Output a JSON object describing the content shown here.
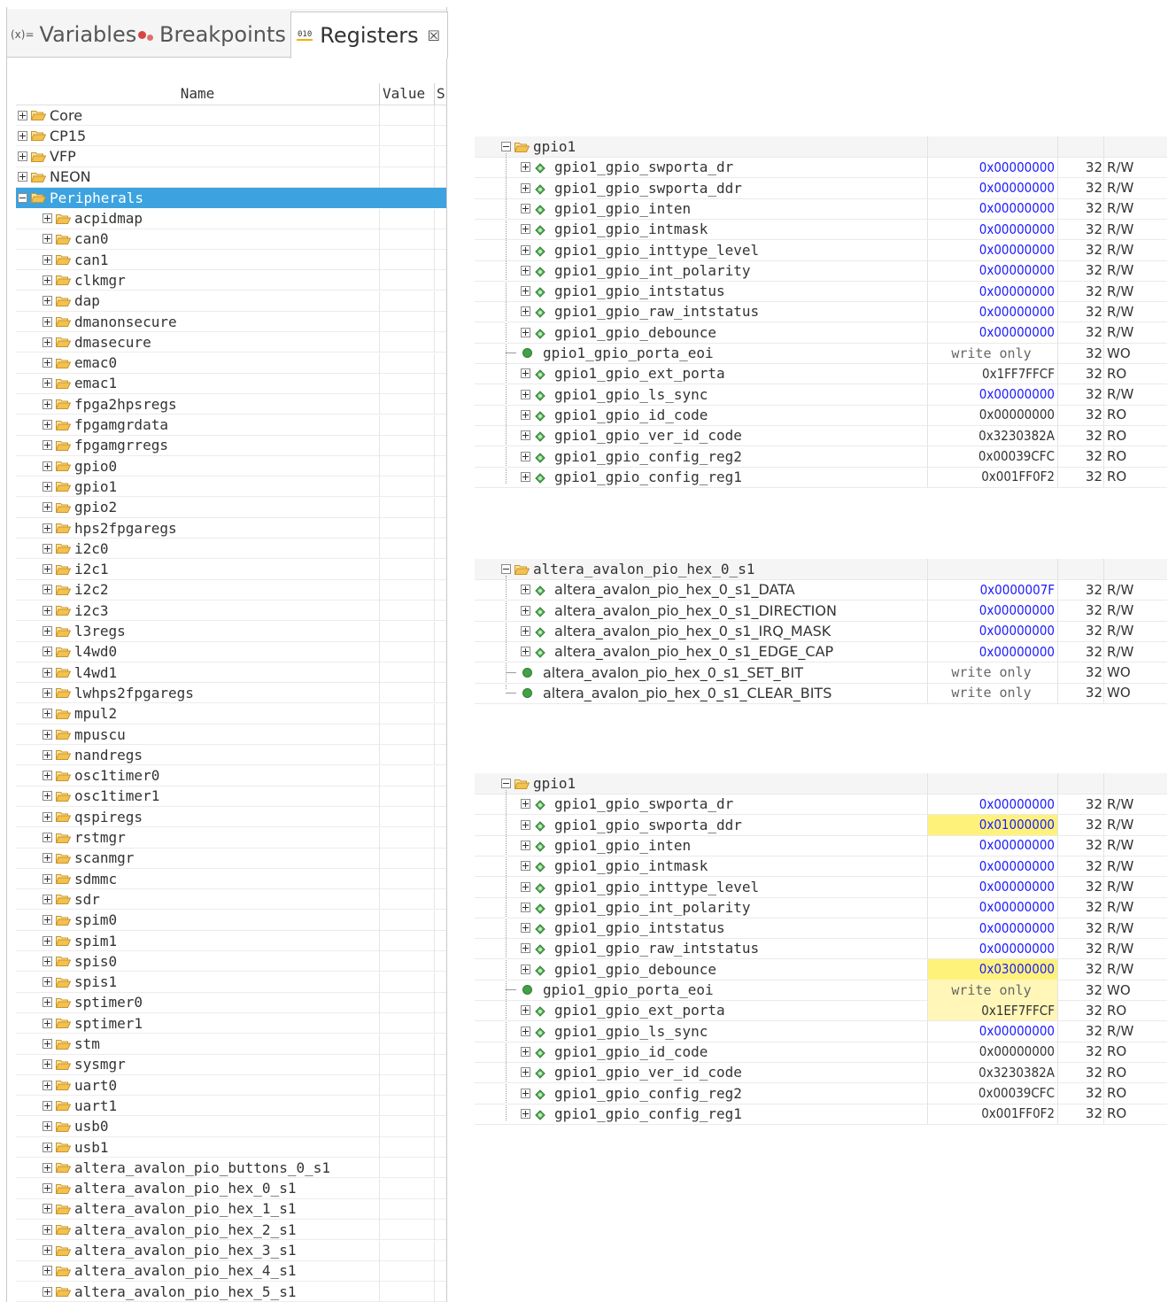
{
  "tabs": [
    {
      "label": "Variables",
      "icon": "variables-icon"
    },
    {
      "label": "Breakpoints",
      "icon": "breakpoints-icon"
    },
    {
      "label": "Registers",
      "icon": "registers-icon",
      "active": true
    }
  ],
  "registers_icon_text": "010",
  "close_glyph": "☒",
  "columns": {
    "name": "Name",
    "value": "Value",
    "s": "S"
  },
  "tree": {
    "top": [
      {
        "label": "Core",
        "sans": true
      },
      {
        "label": "CP15",
        "sans": true
      },
      {
        "label": "VFP",
        "sans": true
      },
      {
        "label": "NEON",
        "sans": true
      },
      {
        "label": "Peripherals",
        "selected": true
      }
    ],
    "peripherals": [
      "acpidmap",
      "can0",
      "can1",
      "clkmgr",
      "dap",
      "dmanonsecure",
      "dmasecure",
      "emac0",
      "emac1",
      "fpga2hpsregs",
      "fpgamgrdata",
      "fpgamgrregs",
      "gpio0",
      "gpio1",
      "gpio2",
      "hps2fpgaregs",
      "i2c0",
      "i2c1",
      "i2c2",
      "i2c3",
      "l3regs",
      "l4wd0",
      "l4wd1",
      "lwhps2fpgaregs",
      "mpul2",
      "mpuscu",
      "nandregs",
      "osc1timer0",
      "osc1timer1",
      "qspiregs",
      "rstmgr",
      "scanmgr",
      "sdmmc",
      "sdr",
      "spim0",
      "spim1",
      "spis0",
      "spis1",
      "sptimer0",
      "sptimer1",
      "stm",
      "sysmgr",
      "uart0",
      "uart1",
      "usb0",
      "usb1",
      "altera_avalon_pio_buttons_0_s1",
      "altera_avalon_pio_hex_0_s1",
      "altera_avalon_pio_hex_1_s1",
      "altera_avalon_pio_hex_2_s1",
      "altera_avalon_pio_hex_3_s1",
      "altera_avalon_pio_hex_4_s1",
      "altera_avalon_pio_hex_5_s1"
    ]
  },
  "tables": [
    {
      "name": "gpio1",
      "rows": [
        {
          "name": "gpio1_gpio_swporta_dr",
          "value": "0x00000000",
          "size": "32",
          "access": "R/W",
          "style": "blue"
        },
        {
          "name": "gpio1_gpio_swporta_ddr",
          "value": "0x00000000",
          "size": "32",
          "access": "R/W",
          "style": "blue"
        },
        {
          "name": "gpio1_gpio_inten",
          "value": "0x00000000",
          "size": "32",
          "access": "R/W",
          "style": "blue"
        },
        {
          "name": "gpio1_gpio_intmask",
          "value": "0x00000000",
          "size": "32",
          "access": "R/W",
          "style": "blue"
        },
        {
          "name": "gpio1_gpio_inttype_level",
          "value": "0x00000000",
          "size": "32",
          "access": "R/W",
          "style": "blue"
        },
        {
          "name": "gpio1_gpio_int_polarity",
          "value": "0x00000000",
          "size": "32",
          "access": "R/W",
          "style": "blue"
        },
        {
          "name": "gpio1_gpio_intstatus",
          "value": "0x00000000",
          "size": "32",
          "access": "R/W",
          "style": "blue"
        },
        {
          "name": "gpio1_gpio_raw_intstatus",
          "value": "0x00000000",
          "size": "32",
          "access": "R/W",
          "style": "blue"
        },
        {
          "name": "gpio1_gpio_debounce",
          "value": "0x00000000",
          "size": "32",
          "access": "R/W",
          "style": "blue"
        },
        {
          "name": "gpio1_gpio_porta_eoi",
          "value": "write only",
          "size": "32",
          "access": "WO",
          "style": "gray",
          "leaf": true
        },
        {
          "name": "gpio1_gpio_ext_porta",
          "value": "0x1FF7FFCF",
          "size": "32",
          "access": "RO",
          "style": "plain"
        },
        {
          "name": "gpio1_gpio_ls_sync",
          "value": "0x00000000",
          "size": "32",
          "access": "R/W",
          "style": "blue"
        },
        {
          "name": "gpio1_gpio_id_code",
          "value": "0x00000000",
          "size": "32",
          "access": "RO",
          "style": "plain"
        },
        {
          "name": "gpio1_gpio_ver_id_code",
          "value": "0x3230382A",
          "size": "32",
          "access": "RO",
          "style": "plain"
        },
        {
          "name": "gpio1_gpio_config_reg2",
          "value": "0x00039CFC",
          "size": "32",
          "access": "RO",
          "style": "plain"
        },
        {
          "name": "gpio1_gpio_config_reg1",
          "value": "0x001FF0F2",
          "size": "32",
          "access": "RO",
          "style": "plain"
        }
      ]
    },
    {
      "name": "altera_avalon_pio_hex_0_s1",
      "rows": [
        {
          "name": "altera_avalon_pio_hex_0_s1_DATA",
          "value": "0x0000007F",
          "size": "32",
          "access": "R/W",
          "style": "blue"
        },
        {
          "name": "altera_avalon_pio_hex_0_s1_DIRECTION",
          "value": "0x00000000",
          "size": "32",
          "access": "R/W",
          "style": "blue"
        },
        {
          "name": "altera_avalon_pio_hex_0_s1_IRQ_MASK",
          "value": "0x00000000",
          "size": "32",
          "access": "R/W",
          "style": "blue"
        },
        {
          "name": "altera_avalon_pio_hex_0_s1_EDGE_CAP",
          "value": "0x00000000",
          "size": "32",
          "access": "R/W",
          "style": "blue"
        },
        {
          "name": "altera_avalon_pio_hex_0_s1_SET_BIT",
          "value": "write only",
          "size": "32",
          "access": "WO",
          "style": "gray",
          "leaf": true
        },
        {
          "name": "altera_avalon_pio_hex_0_s1_CLEAR_BITS",
          "value": "write only",
          "size": "32",
          "access": "WO",
          "style": "gray",
          "leaf": true,
          "last": true
        }
      ]
    },
    {
      "name": "gpio1",
      "rows": [
        {
          "name": "gpio1_gpio_swporta_dr",
          "value": "0x00000000",
          "size": "32",
          "access": "R/W",
          "style": "blue"
        },
        {
          "name": "gpio1_gpio_swporta_ddr",
          "value": "0x01000000",
          "size": "32",
          "access": "R/W",
          "style": "blue",
          "highlight": "hl"
        },
        {
          "name": "gpio1_gpio_inten",
          "value": "0x00000000",
          "size": "32",
          "access": "R/W",
          "style": "blue"
        },
        {
          "name": "gpio1_gpio_intmask",
          "value": "0x00000000",
          "size": "32",
          "access": "R/W",
          "style": "blue"
        },
        {
          "name": "gpio1_gpio_inttype_level",
          "value": "0x00000000",
          "size": "32",
          "access": "R/W",
          "style": "blue"
        },
        {
          "name": "gpio1_gpio_int_polarity",
          "value": "0x00000000",
          "size": "32",
          "access": "R/W",
          "style": "blue"
        },
        {
          "name": "gpio1_gpio_intstatus",
          "value": "0x00000000",
          "size": "32",
          "access": "R/W",
          "style": "blue"
        },
        {
          "name": "gpio1_gpio_raw_intstatus",
          "value": "0x00000000",
          "size": "32",
          "access": "R/W",
          "style": "blue"
        },
        {
          "name": "gpio1_gpio_debounce",
          "value": "0x03000000",
          "size": "32",
          "access": "R/W",
          "style": "blue",
          "highlight": "hl"
        },
        {
          "name": "gpio1_gpio_porta_eoi",
          "value": "write only",
          "size": "32",
          "access": "WO",
          "style": "gray",
          "leaf": true,
          "highlight": "hlsoft"
        },
        {
          "name": "gpio1_gpio_ext_porta",
          "value": "0x1EF7FFCF",
          "size": "32",
          "access": "RO",
          "style": "plain",
          "highlight": "hlsoft"
        },
        {
          "name": "gpio1_gpio_ls_sync",
          "value": "0x00000000",
          "size": "32",
          "access": "R/W",
          "style": "blue"
        },
        {
          "name": "gpio1_gpio_id_code",
          "value": "0x00000000",
          "size": "32",
          "access": "RO",
          "style": "plain"
        },
        {
          "name": "gpio1_gpio_ver_id_code",
          "value": "0x3230382A",
          "size": "32",
          "access": "RO",
          "style": "plain"
        },
        {
          "name": "gpio1_gpio_config_reg2",
          "value": "0x00039CFC",
          "size": "32",
          "access": "RO",
          "style": "plain"
        },
        {
          "name": "gpio1_gpio_config_reg1",
          "value": "0x001FF0F2",
          "size": "32",
          "access": "RO",
          "style": "plain"
        }
      ]
    }
  ],
  "colors": {
    "selection": "#3ca3e0",
    "value_blue": "#1a1aff",
    "changed_highlight": "#fff27a",
    "folder": "#f2c14e",
    "register_green": "#43a047"
  }
}
